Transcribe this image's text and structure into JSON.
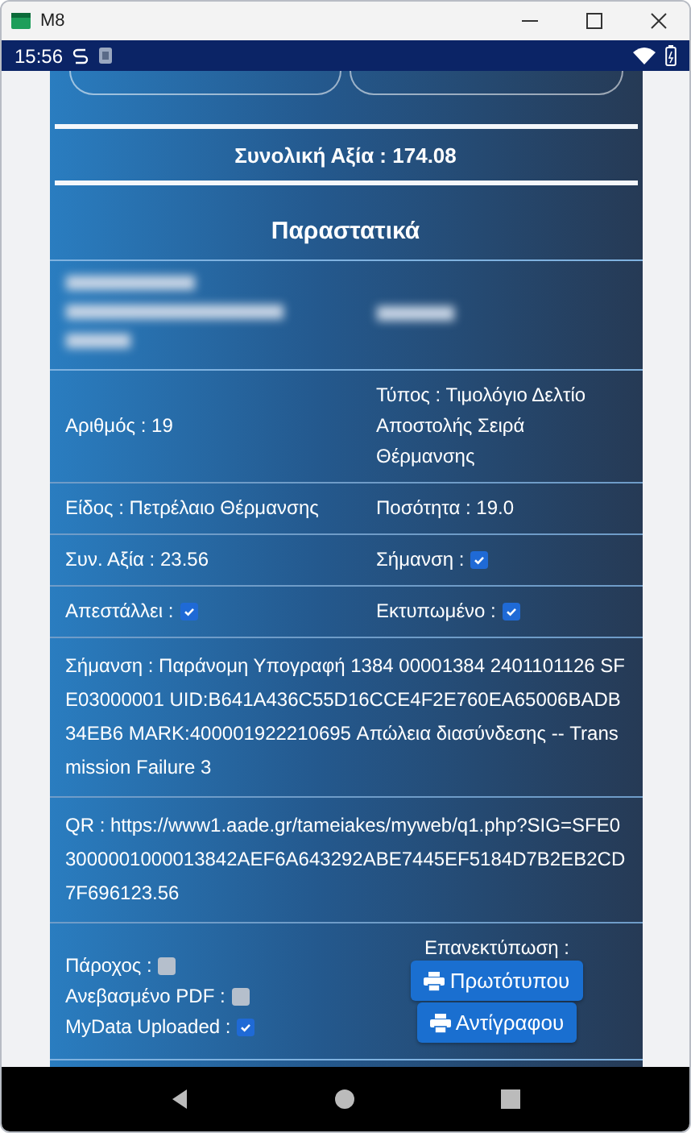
{
  "window": {
    "title": "M8"
  },
  "status_bar": {
    "time": "15:56"
  },
  "summary": {
    "total": "Συνολική Αξία : 174.08"
  },
  "documents": {
    "title": "Παραστατικά",
    "rows": [
      {
        "kind": "redacted"
      },
      {
        "kind": "pair",
        "cells": [
          {
            "label": "Αριθμός : 19"
          },
          {
            "label": "Τύπος : Τιμολόγιο Δελτίο Αποστολής Σειρά Θέρμανσης"
          }
        ]
      },
      {
        "kind": "pair",
        "cells": [
          {
            "label": "Είδος : Πετρέλαιο Θέρμανσης"
          },
          {
            "label": "Ποσότητα : 19.0"
          }
        ]
      },
      {
        "kind": "pair",
        "cells": [
          {
            "label": "Συν. Αξία : 23.56"
          },
          {
            "label": "Σήμανση :",
            "checked": true
          }
        ]
      },
      {
        "kind": "pair",
        "cells": [
          {
            "label": "Απεστάλλει :",
            "checked": true
          },
          {
            "label": "Εκτυπωμένο :",
            "checked": true
          }
        ]
      },
      {
        "kind": "text",
        "text": "Σήμανση : Παράνομη Υπογραφή 1384 00001384 2401101126 SFE03000001 UID:B641A436C55D16CCE4F2E760EA65006BADB34EB6 MARK:400001922210695 Απώλεια διασύνδεσης -- Transmission Failure 3"
      },
      {
        "kind": "text",
        "text": "QR : https://www1.aade.gr/tameiakes/myweb/q1.php?SIG=SFE03000001000013842AEF6A643292ABE7445EF5184D7B2EB2CD7F696123.56"
      }
    ],
    "flags": [
      {
        "label": "Πάροχος :",
        "checked": false
      },
      {
        "label": "Ανεβασμένο PDF :",
        "checked": false
      },
      {
        "label": "MyData Uploaded :",
        "checked": true
      }
    ],
    "reprint": {
      "label": "Επανεκτύπωση :",
      "buttons": [
        "Πρωτότυπου",
        "Αντίγραφου"
      ]
    }
  }
}
